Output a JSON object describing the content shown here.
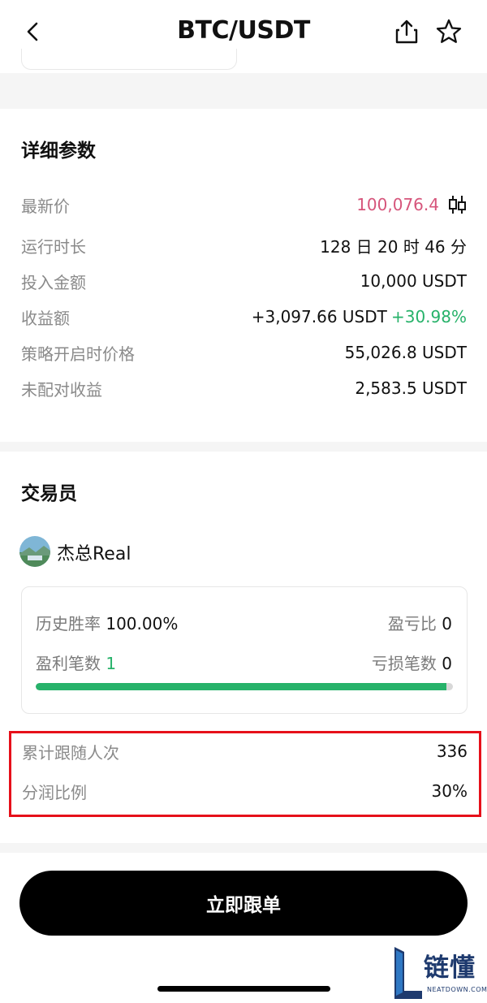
{
  "header": {
    "title": "BTC/USDT"
  },
  "params": {
    "title": "详细参数",
    "latest_price_label": "最新价",
    "latest_price_value": "100,076.4",
    "run_time_label": "运行时长",
    "run_time_value": "128 日 20 时 46 分",
    "investment_label": "投入金额",
    "investment_value": "10,000 USDT",
    "profit_label": "收益额",
    "profit_value": "+3,097.66 USDT",
    "profit_pct": "+30.98%",
    "start_price_label": "策略开启时价格",
    "start_price_value": "55,026.8 USDT",
    "unpaired_label": "未配对收益",
    "unpaired_value": "2,583.5 USDT"
  },
  "trader": {
    "title": "交易员",
    "name": "杰总Real",
    "win_rate_label": "历史胜率",
    "win_rate_value": "100.00%",
    "pl_ratio_label": "盈亏比",
    "pl_ratio_value": "0",
    "profit_trades_label": "盈利笔数",
    "profit_trades_value": "1",
    "loss_trades_label": "亏损笔数",
    "loss_trades_value": "0",
    "win_fraction": 0.985,
    "followers_label": "累计跟随人次",
    "followers_value": "336",
    "share_label": "分润比例",
    "share_value": "30%"
  },
  "footer": {
    "button_label": "立即跟单"
  },
  "watermark": {
    "cn": "链懂",
    "en": "NEATDOWN.COM"
  },
  "colors": {
    "profit_green": "#27b26a",
    "price_red": "#d6557b",
    "highlight_red": "#e6101a"
  }
}
